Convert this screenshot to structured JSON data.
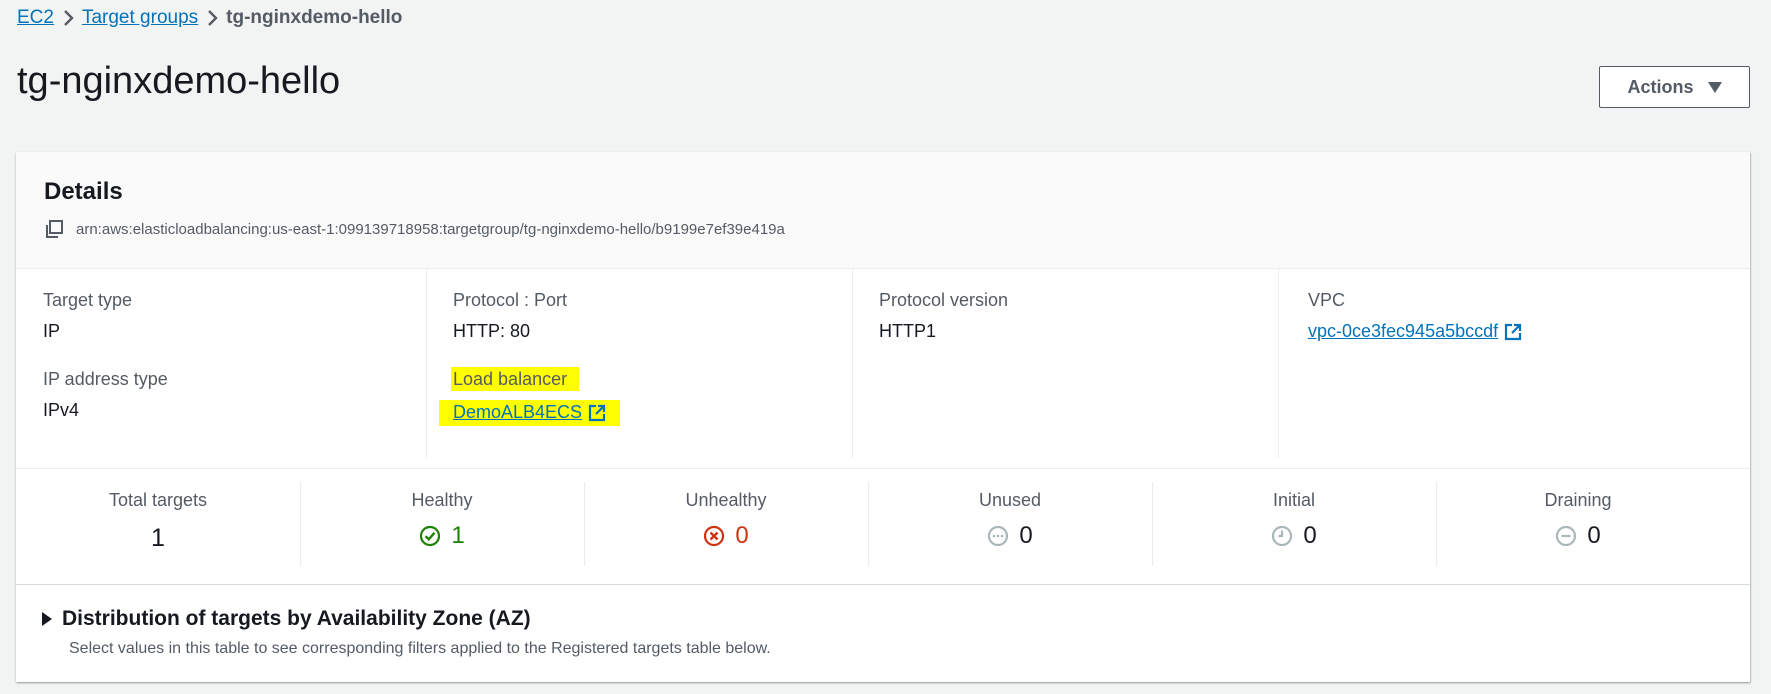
{
  "breadcrumb": {
    "items": [
      {
        "label": "EC2"
      },
      {
        "label": "Target groups"
      }
    ],
    "current": "tg-nginxdemo-hello"
  },
  "header": {
    "title": "tg-nginxdemo-hello",
    "actions_label": "Actions"
  },
  "details": {
    "title": "Details",
    "arn": "arn:aws:elasticloadbalancing:us-east-1:099139718958:targetgroup/tg-nginxdemo-hello/b9199e7ef39e419a",
    "target_type": {
      "label": "Target type",
      "value": "IP"
    },
    "protocol_port": {
      "label": "Protocol : Port",
      "value": "HTTP: 80"
    },
    "protocol_version": {
      "label": "Protocol version",
      "value": "HTTP1"
    },
    "vpc": {
      "label": "VPC",
      "value": "vpc-0ce3fec945a5bccdf"
    },
    "ip_address_type": {
      "label": "IP address type",
      "value": "IPv4"
    },
    "load_balancer": {
      "label": "Load balancer",
      "value": "DemoALB4ECS"
    },
    "highlight_color": "#ffff00"
  },
  "stats": {
    "total": {
      "label": "Total targets",
      "value": "1"
    },
    "healthy": {
      "label": "Healthy",
      "value": "1",
      "color": "#1d8102",
      "icon": "check-circle-icon"
    },
    "unhealthy": {
      "label": "Unhealthy",
      "value": "0",
      "color": "#d13212",
      "icon": "x-circle-icon"
    },
    "unused": {
      "label": "Unused",
      "value": "0",
      "icon": "ellipsis-circle-icon"
    },
    "initial": {
      "label": "Initial",
      "value": "0",
      "icon": "clock-icon"
    },
    "draining": {
      "label": "Draining",
      "value": "0",
      "icon": "minus-circle-icon"
    }
  },
  "distribution": {
    "title": "Distribution of targets by Availability Zone (AZ)",
    "description": "Select values in this table to see corresponding filters applied to the Registered targets table below."
  },
  "colors": {
    "link": "#0073bb",
    "page_bg": "#f2f3f3",
    "text": "#16191f",
    "secondary_text": "#545b64"
  }
}
